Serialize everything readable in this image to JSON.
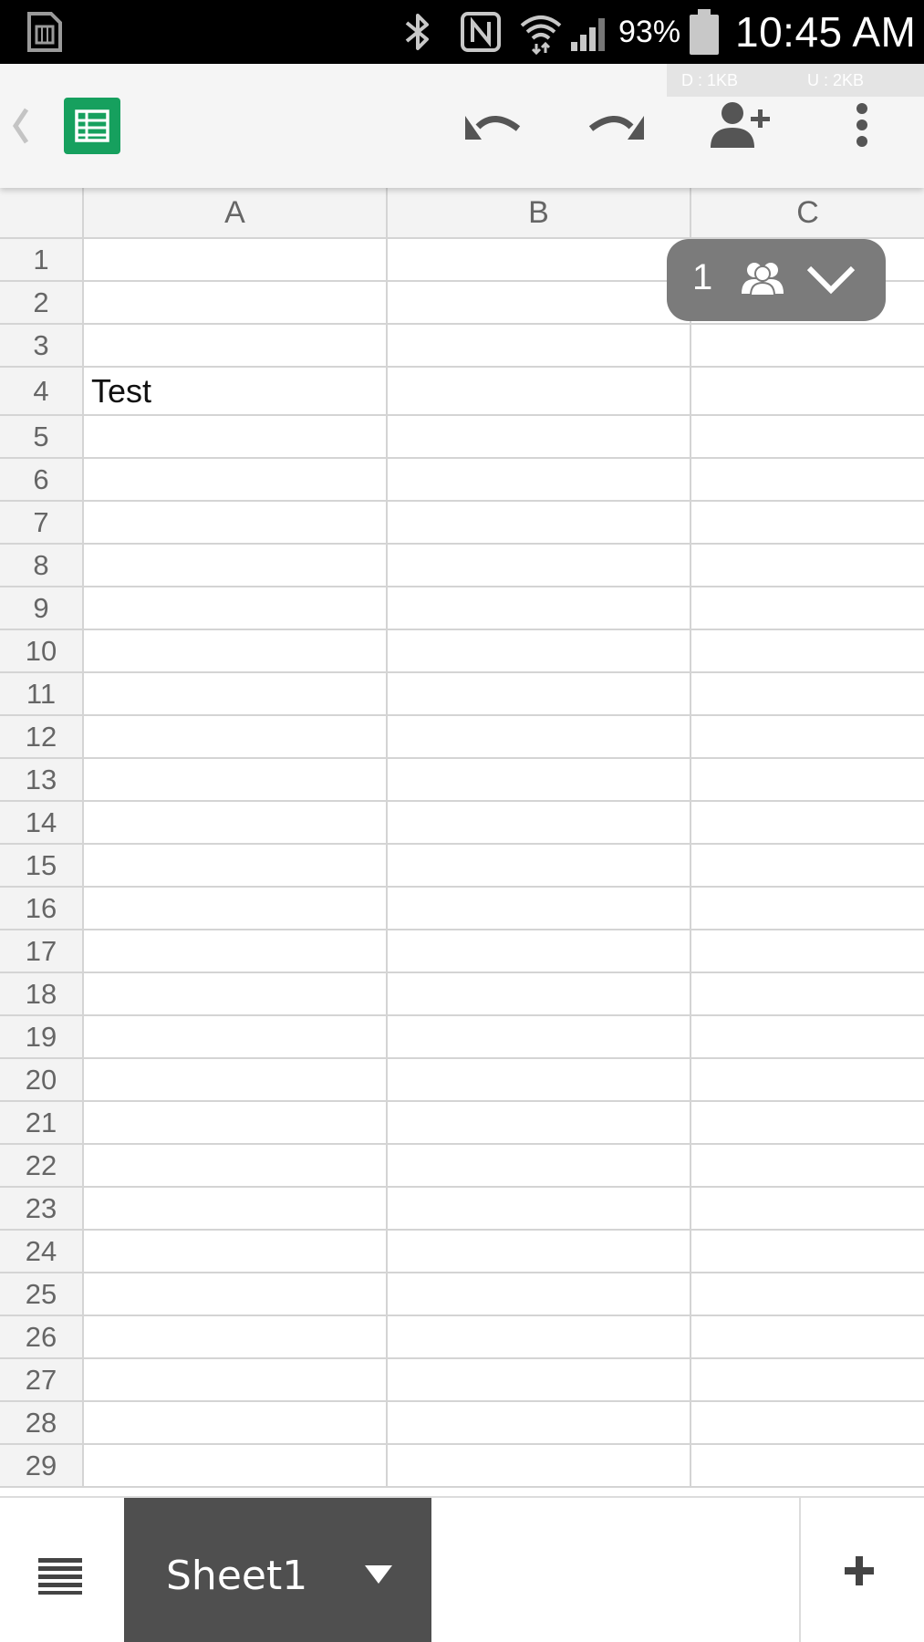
{
  "status_bar": {
    "battery_percent": "93%",
    "time": "10:45 AM",
    "icons": [
      "sim-card-icon",
      "bluetooth-icon",
      "nfc-icon",
      "wifi-icon",
      "cell-signal-icon",
      "battery-icon"
    ]
  },
  "toolbar": {
    "net_down": "D : 1KB",
    "net_up": "U : 2KB",
    "icons": [
      "back-chevron-icon",
      "sheets-logo-icon",
      "undo-icon",
      "redo-icon",
      "add-person-icon",
      "more-vert-icon"
    ],
    "accent_color": "#16a05e"
  },
  "grid": {
    "columns": [
      "A",
      "B",
      "C"
    ],
    "rows": [
      {
        "num": "1",
        "a": "",
        "b": "",
        "c": ""
      },
      {
        "num": "2",
        "a": "",
        "b": "",
        "c": ""
      },
      {
        "num": "3",
        "a": "",
        "b": "",
        "c": ""
      },
      {
        "num": "4",
        "a": "Test",
        "b": "",
        "c": ""
      },
      {
        "num": "5",
        "a": "",
        "b": "",
        "c": ""
      },
      {
        "num": "6",
        "a": "",
        "b": "",
        "c": ""
      },
      {
        "num": "7",
        "a": "",
        "b": "",
        "c": ""
      },
      {
        "num": "8",
        "a": "",
        "b": "",
        "c": ""
      },
      {
        "num": "9",
        "a": "",
        "b": "",
        "c": ""
      },
      {
        "num": "10",
        "a": "",
        "b": "",
        "c": ""
      },
      {
        "num": "11",
        "a": "",
        "b": "",
        "c": ""
      },
      {
        "num": "12",
        "a": "",
        "b": "",
        "c": ""
      },
      {
        "num": "13",
        "a": "",
        "b": "",
        "c": ""
      },
      {
        "num": "14",
        "a": "",
        "b": "",
        "c": ""
      },
      {
        "num": "15",
        "a": "",
        "b": "",
        "c": ""
      },
      {
        "num": "16",
        "a": "",
        "b": "",
        "c": ""
      },
      {
        "num": "17",
        "a": "",
        "b": "",
        "c": ""
      },
      {
        "num": "18",
        "a": "",
        "b": "",
        "c": ""
      },
      {
        "num": "19",
        "a": "",
        "b": "",
        "c": ""
      },
      {
        "num": "20",
        "a": "",
        "b": "",
        "c": ""
      },
      {
        "num": "21",
        "a": "",
        "b": "",
        "c": ""
      },
      {
        "num": "22",
        "a": "",
        "b": "",
        "c": ""
      },
      {
        "num": "23",
        "a": "",
        "b": "",
        "c": ""
      },
      {
        "num": "24",
        "a": "",
        "b": "",
        "c": ""
      },
      {
        "num": "25",
        "a": "",
        "b": "",
        "c": ""
      },
      {
        "num": "26",
        "a": "",
        "b": "",
        "c": ""
      },
      {
        "num": "27",
        "a": "",
        "b": "",
        "c": ""
      },
      {
        "num": "28",
        "a": "",
        "b": "",
        "c": ""
      },
      {
        "num": "29",
        "a": "",
        "b": "",
        "c": ""
      }
    ]
  },
  "collaborators": {
    "count": "1",
    "icons": [
      "people-icon",
      "chevron-down-icon"
    ]
  },
  "bottom_bar": {
    "active_sheet": "Sheet1",
    "icons": [
      "sheet-list-icon",
      "dropdown-arrow-icon",
      "add-icon"
    ]
  }
}
